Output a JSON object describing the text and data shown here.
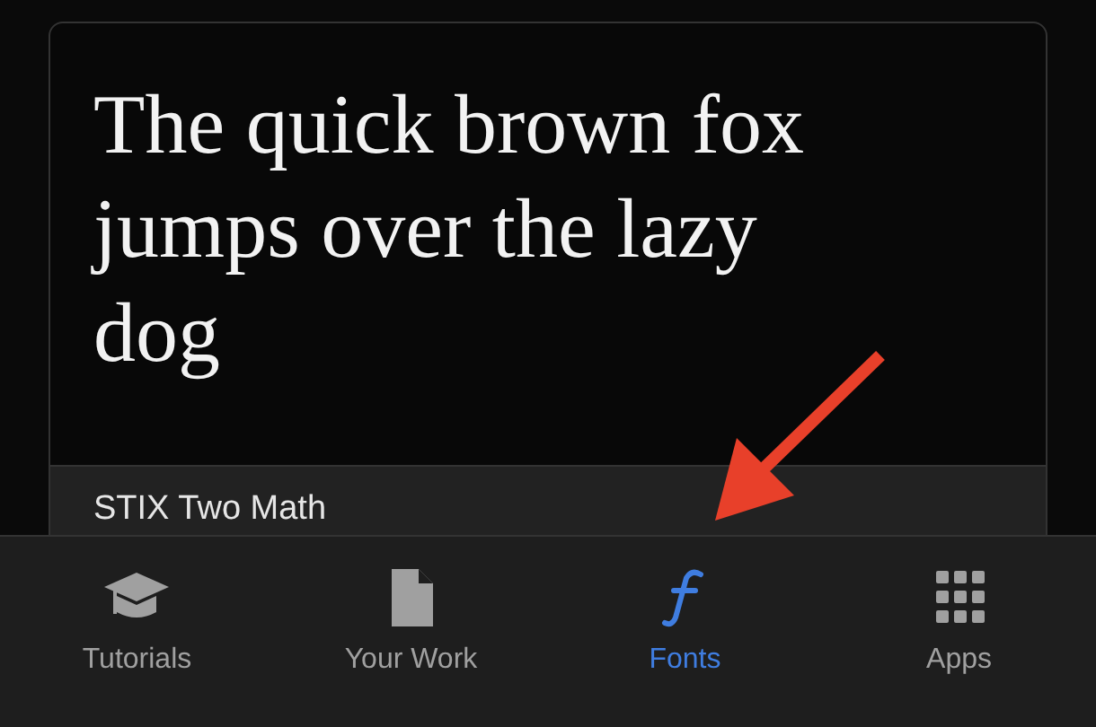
{
  "font_card": {
    "sample": "The quick brown fox jumps over the lazy dog",
    "font_name": "STIX Two Math"
  },
  "tabs": [
    {
      "label": "Tutorials",
      "selected": false
    },
    {
      "label": "Your Work",
      "selected": false
    },
    {
      "label": "Fonts",
      "selected": true
    },
    {
      "label": "Apps",
      "selected": false
    }
  ]
}
